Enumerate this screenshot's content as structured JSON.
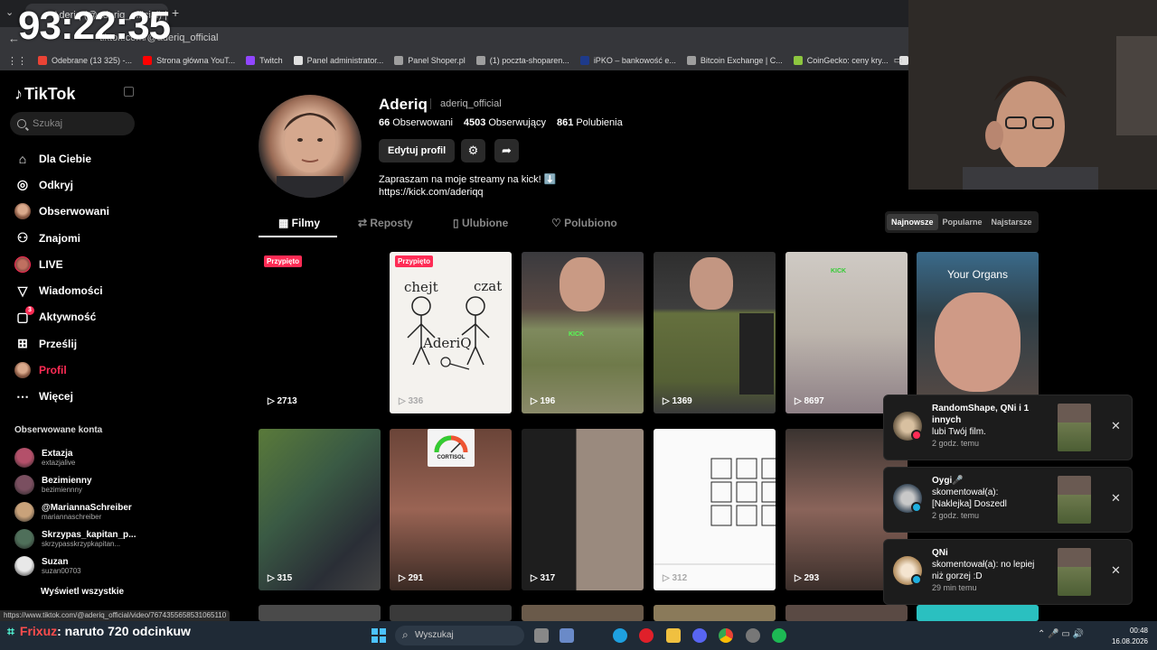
{
  "overlay": {
    "timer": "93:22:35"
  },
  "browser": {
    "tab_title": "Aderiq (@aderiq_official) | TikTok",
    "url": "tiktok.com/@aderiq_official",
    "bookmarks": [
      {
        "label": "Odebrane (13 325) -...",
        "icon": "gmail-icon",
        "color": "#ea4335"
      },
      {
        "label": "Strona główna YouT...",
        "icon": "youtube-icon",
        "color": "#ff0000"
      },
      {
        "label": "Twitch",
        "icon": "twitch-icon",
        "color": "#9146ff"
      },
      {
        "label": "Panel administrator...",
        "icon": "page-icon",
        "color": "#e0e0e0"
      },
      {
        "label": "Panel Shoper.pl",
        "icon": "globe-icon",
        "color": "#9e9e9e"
      },
      {
        "label": "(1) poczta-shoparen...",
        "icon": "globe-icon",
        "color": "#9e9e9e"
      },
      {
        "label": "iPKO – bankowość e...",
        "icon": "bank-icon",
        "color": "#1e3a8a"
      },
      {
        "label": "Bitcoin Exchange | C...",
        "icon": "globe-icon",
        "color": "#9e9e9e"
      },
      {
        "label": "CoinGecko: ceny kry...",
        "icon": "coingecko-icon",
        "color": "#8dc63f"
      },
      {
        "label": "The best ChatBot an...",
        "icon": "chatbot-icon",
        "color": "#e0e0e0"
      }
    ]
  },
  "sidebar": {
    "logo": "TikTok",
    "search_placeholder": "Szukaj",
    "nav": [
      {
        "label": "Dla Ciebie",
        "icon": "home-icon"
      },
      {
        "label": "Odkryj",
        "icon": "compass-icon"
      },
      {
        "label": "Obserwowani",
        "icon": "following-avatar-icon"
      },
      {
        "label": "Znajomi",
        "icon": "friends-icon"
      },
      {
        "label": "LIVE",
        "icon": "live-icon"
      },
      {
        "label": "Wiadomości",
        "icon": "send-icon"
      },
      {
        "label": "Aktywność",
        "icon": "inbox-icon",
        "badge": "3"
      },
      {
        "label": "Prześlij",
        "icon": "upload-icon"
      },
      {
        "label": "Profil",
        "icon": "profile-avatar-icon"
      },
      {
        "label": "Więcej",
        "icon": "more-icon"
      }
    ],
    "following_title": "Obserwowane konta",
    "following": [
      {
        "name": "Extazja",
        "handle": "extazjalive",
        "color": "#b4506a"
      },
      {
        "name": "Bezimienny",
        "handle": "bezimiennny",
        "color": "#7a4f60"
      },
      {
        "name": "@MariannaSchreiber",
        "handle": "mariannaschreiber",
        "color": "#c9a27a"
      },
      {
        "name": "Skrzypas_kapitan_p...",
        "handle": "skrzypasskrzypkapitan...",
        "color": "#4f6f5a"
      },
      {
        "name": "Suzan",
        "handle": "suzan00703",
        "color": "#e8e8e8"
      }
    ],
    "show_all": "Wyświetl wszystkie"
  },
  "profile": {
    "name": "Aderiq",
    "handle": "aderiq_official",
    "following_count": "66",
    "following_label": "Obserwowani",
    "followers_count": "4503",
    "followers_label": "Obserwujący",
    "likes_count": "861",
    "likes_label": "Polubienia",
    "edit_label": "Edytuj profil",
    "bio_line1": "Zapraszam na moje streamy na kick! ⬇️",
    "bio_line2": "https://kick.com/aderiqq"
  },
  "tabs": [
    {
      "label": "Filmy",
      "icon": "grid-icon"
    },
    {
      "label": "Reposty",
      "icon": "repost-icon"
    },
    {
      "label": "Ulubione",
      "icon": "bookmark-icon"
    },
    {
      "label": "Polubiono",
      "icon": "heart-outline-icon"
    }
  ],
  "sort": [
    "Najnowsze",
    "Popularne",
    "Najstarsze"
  ],
  "videos": [
    {
      "views": "2713",
      "pinned": "Przypięto"
    },
    {
      "views": "336",
      "pinned": "Przypięto",
      "drawing": {
        "left": "chejt",
        "right": "czat",
        "name": "AderiQ"
      }
    },
    {
      "views": "196",
      "tag": "KICK"
    },
    {
      "views": "1369"
    },
    {
      "views": "8697",
      "tag": "KICK"
    },
    {
      "views": "",
      "overlay": "Your Organs"
    },
    {
      "views": "315"
    },
    {
      "views": "291",
      "gauge": "CORTISOL"
    },
    {
      "views": "317"
    },
    {
      "views": "312"
    },
    {
      "views": "293"
    }
  ],
  "notifications": [
    {
      "actor": "RandomShape, QNi i 1 innych",
      "text": "lubi Twój film.",
      "time": "2 godz. temu",
      "badge_color": "#fe2c55"
    },
    {
      "actor": "Oygi🎤",
      "text": "skomentował(a): [Naklejka] Doszedl",
      "time": "2 godz. temu",
      "badge_color": "#20b0e0"
    },
    {
      "actor": "QNi",
      "text": "skomentował(a): no lepiej niż gorzej :D",
      "time": "29 min temu",
      "badge_color": "#20b0e0"
    }
  ],
  "status_url": "https://www.tiktok.com/@aderiq_official/video/7674355658531065110",
  "chat_overlay": {
    "user": "Frixuz",
    "message": ": naruto 720 odcinkuw"
  },
  "taskbar": {
    "search_placeholder": "Wyszukaj",
    "time": "00:48",
    "date": "16.08.2026"
  }
}
